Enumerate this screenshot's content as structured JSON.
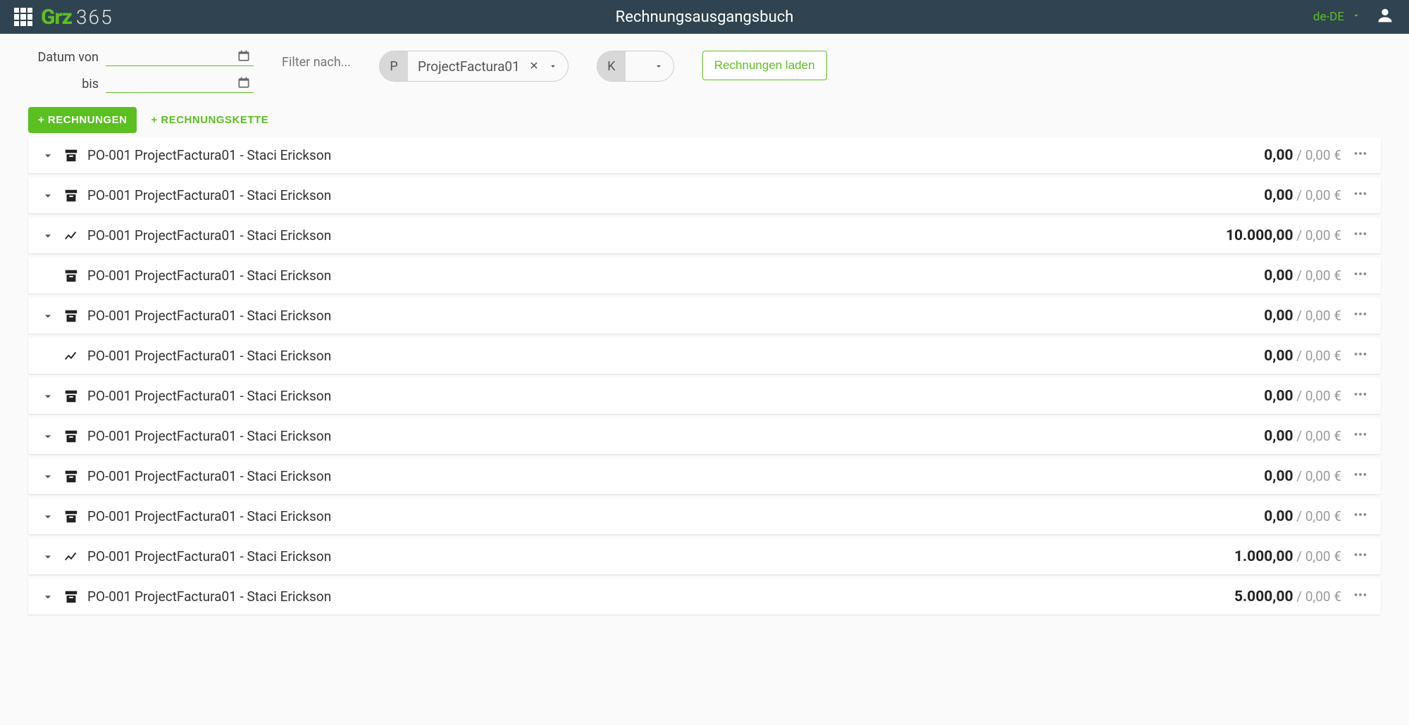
{
  "header": {
    "title": "Rechnungsausgangsbuch",
    "logo_365": "365",
    "lang": "de-DE"
  },
  "filters": {
    "date_from_label": "Datum von",
    "date_to_label": "bis",
    "filter_label": "Filter nach...",
    "chip_p_prefix": "P",
    "chip_p_value": "ProjectFactura01",
    "chip_k_prefix": "K",
    "chip_k_value": "",
    "load_button": "Rechnungen laden"
  },
  "actions": {
    "add_invoice": "+ RECHNUNGEN",
    "add_chain": "+ RECHNUNGSKETTE"
  },
  "row_label_text": "PO-001 ProjectFactura01 - Staci Erickson",
  "currency": "€",
  "rows": [
    {
      "expandable": true,
      "icon": "archive",
      "primary": "0,00",
      "secondary": "0,00"
    },
    {
      "expandable": true,
      "icon": "archive",
      "primary": "0,00",
      "secondary": "0,00"
    },
    {
      "expandable": true,
      "icon": "trend",
      "primary": "10.000,00",
      "secondary": "0,00"
    },
    {
      "expandable": false,
      "icon": "archive",
      "primary": "0,00",
      "secondary": "0,00"
    },
    {
      "expandable": true,
      "icon": "archive",
      "primary": "0,00",
      "secondary": "0,00"
    },
    {
      "expandable": false,
      "icon": "trend",
      "primary": "0,00",
      "secondary": "0,00"
    },
    {
      "expandable": true,
      "icon": "archive",
      "primary": "0,00",
      "secondary": "0,00"
    },
    {
      "expandable": true,
      "icon": "archive",
      "primary": "0,00",
      "secondary": "0,00"
    },
    {
      "expandable": true,
      "icon": "archive",
      "primary": "0,00",
      "secondary": "0,00"
    },
    {
      "expandable": true,
      "icon": "archive",
      "primary": "0,00",
      "secondary": "0,00"
    },
    {
      "expandable": true,
      "icon": "trend",
      "primary": "1.000,00",
      "secondary": "0,00"
    },
    {
      "expandable": true,
      "icon": "archive",
      "primary": "5.000,00",
      "secondary": "0,00"
    }
  ]
}
